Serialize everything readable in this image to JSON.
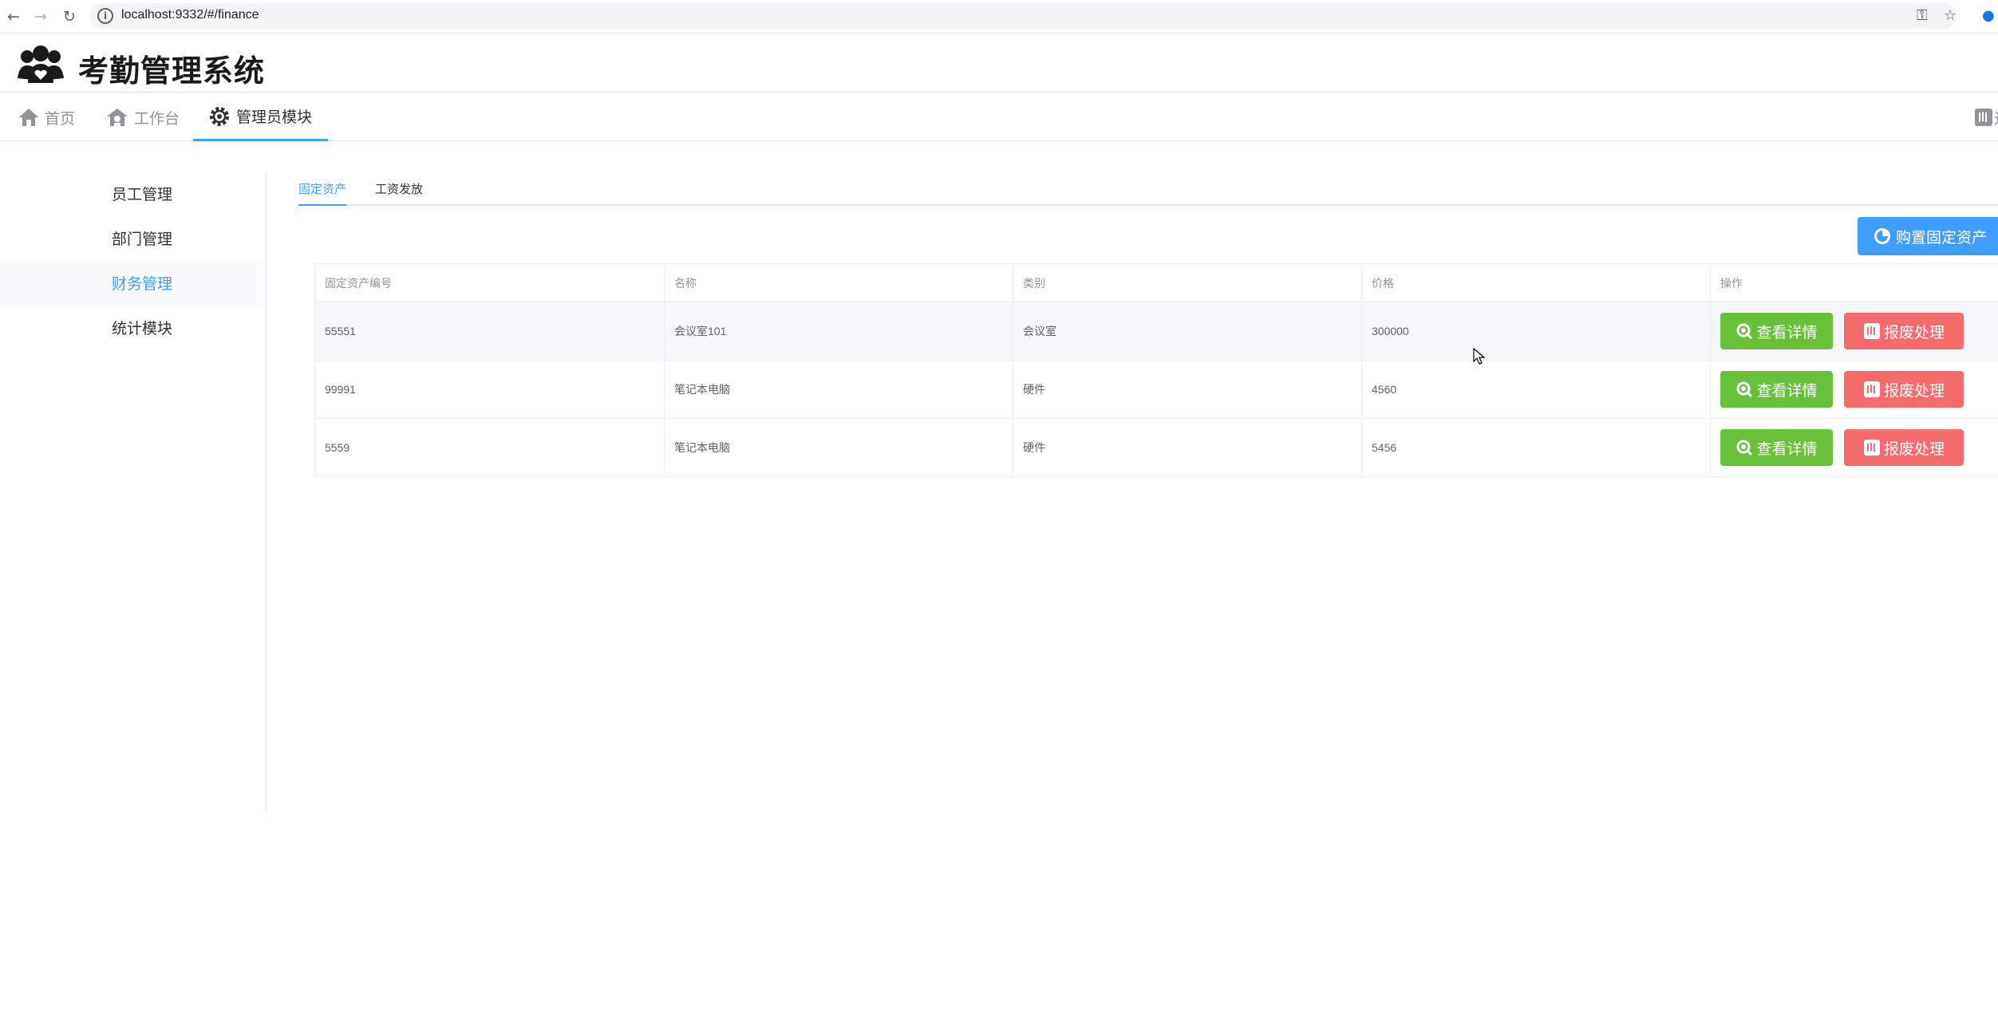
{
  "browser": {
    "url": "localhost:9332/#/finance"
  },
  "app": {
    "title": "考勤管理系统"
  },
  "topmenu": {
    "items": [
      {
        "label": "首页",
        "icon": "home-icon"
      },
      {
        "label": "工作台",
        "icon": "workbench-icon"
      },
      {
        "label": "管理员模块",
        "icon": "gear-icon",
        "active": true
      }
    ],
    "logout_label": "退"
  },
  "sidemenu": {
    "items": [
      {
        "label": "员工管理"
      },
      {
        "label": "部门管理"
      },
      {
        "label": "财务管理",
        "active": true
      },
      {
        "label": "统计模块"
      }
    ]
  },
  "tabs": [
    {
      "label": "固定资产",
      "active": true
    },
    {
      "label": "工资发放"
    }
  ],
  "purchase_button": "购置固定资产",
  "table": {
    "columns": [
      "固定资产编号",
      "名称",
      "类别",
      "价格",
      "操作"
    ],
    "rows": [
      {
        "id": "55551",
        "name": "会议室101",
        "category": "会议室",
        "price": "300000"
      },
      {
        "id": "99991",
        "name": "笔记本电脑",
        "category": "硬件",
        "price": "4560"
      },
      {
        "id": "5559",
        "name": "笔记本电脑",
        "category": "硬件",
        "price": "5456"
      }
    ],
    "detail_label": "查看详情",
    "scrap_label": "报废处理"
  },
  "colors": {
    "primary": "#409eff",
    "success": "#67c23a",
    "danger": "#f56c6c"
  }
}
